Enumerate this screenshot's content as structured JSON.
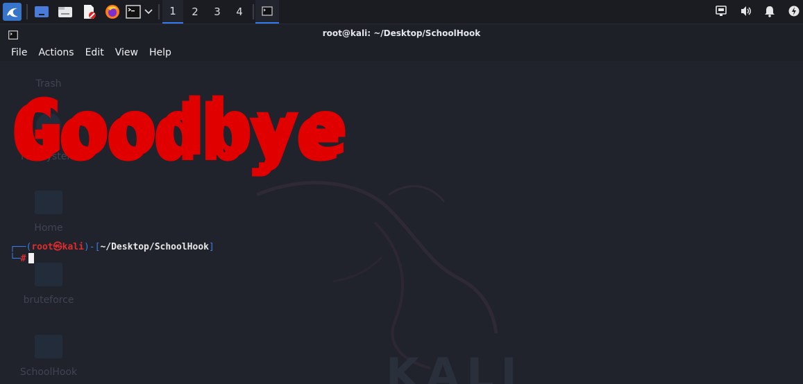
{
  "panel": {
    "app_menu_icon": "kali-dragon-icon",
    "launchers": [
      "desktop-icon",
      "file-manager-icon",
      "text-editor-icon",
      "firefox-icon",
      "terminal-icon"
    ],
    "dropdown_icon": "chevron-down-icon",
    "workspaces": [
      "1",
      "2",
      "3",
      "4"
    ],
    "active_workspace": "1",
    "tray_icons": [
      "network-icon",
      "volume-icon",
      "notification-bell-icon",
      "power-icon"
    ]
  },
  "window": {
    "title": "root@kali: ~/Desktop/SchoolHook"
  },
  "menu": {
    "items": [
      "File",
      "Actions",
      "Edit",
      "View",
      "Help"
    ]
  },
  "terminal": {
    "banner": "Goodbye",
    "prompt": {
      "user": "root",
      "at": "㉿",
      "host": "kali",
      "path": "~/Desktop/SchoolHook",
      "symbol": "#"
    }
  },
  "desktop": {
    "icons": [
      "Trash",
      "File System",
      "Home",
      "bruteforce",
      "SchoolHook"
    ],
    "watermark": "KALI"
  },
  "colors": {
    "banner": "#e10000",
    "prompt_blue": "#3b7be6",
    "prompt_red": "#e02c2c",
    "accent": "#367bf0"
  }
}
